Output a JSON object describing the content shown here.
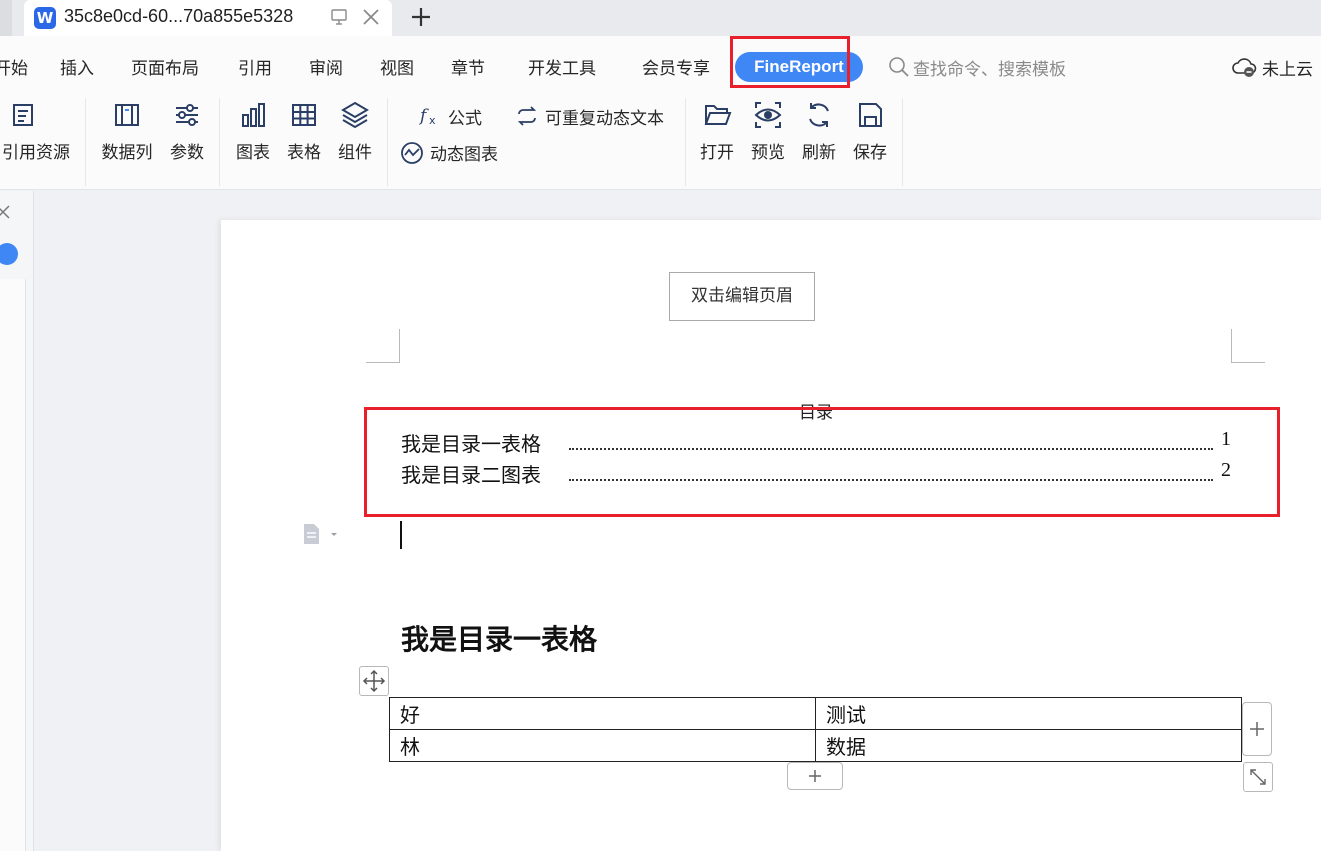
{
  "tab": {
    "title": "35c8e0cd-60...70a855e5328",
    "app_icon": "W",
    "new_tab": "+"
  },
  "menu": {
    "items": [
      "开始",
      "插入",
      "页面布局",
      "引用",
      "审阅",
      "视图",
      "章节",
      "开发工具",
      "会员专享"
    ],
    "active": "FineReport",
    "search_placeholder": "查找命令、搜索模板",
    "cloud_status": "未上云"
  },
  "ribbon": {
    "resource": "引用资源",
    "data_column": "数据列",
    "params": "参数",
    "chart": "图表",
    "table": "表格",
    "component": "组件",
    "formula": "公式",
    "repeat_text": "可重复动态文本",
    "dynamic_chart": "动态图表",
    "open": "打开",
    "preview": "预览",
    "refresh": "刷新",
    "save": "保存"
  },
  "doc": {
    "header_hint": "双击编辑页眉",
    "toc": {
      "title": "目录",
      "entries": [
        {
          "text": "我是目录一表格",
          "page": "1"
        },
        {
          "text": "我是目录二图表",
          "page": "2"
        }
      ]
    },
    "heading": "我是目录一表格",
    "table": [
      [
        "好",
        "测试"
      ],
      [
        "林",
        "数据"
      ]
    ]
  },
  "colors": {
    "accent": "#3e87f4",
    "highlight_box": "#e8202b"
  },
  "icons": [
    "word-app-icon",
    "monitor-icon",
    "close-icon",
    "plus-icon",
    "search-icon",
    "cloud-icon",
    "resource-icon",
    "data-column-icon",
    "params-icon",
    "chart-icon",
    "table-icon",
    "layers-icon",
    "formula-icon",
    "repeat-text-icon",
    "dynamic-chart-icon",
    "folder-open-icon",
    "eye-icon",
    "refresh-icon",
    "save-icon",
    "move-icon",
    "resize-icon",
    "paragraph-icon"
  ]
}
